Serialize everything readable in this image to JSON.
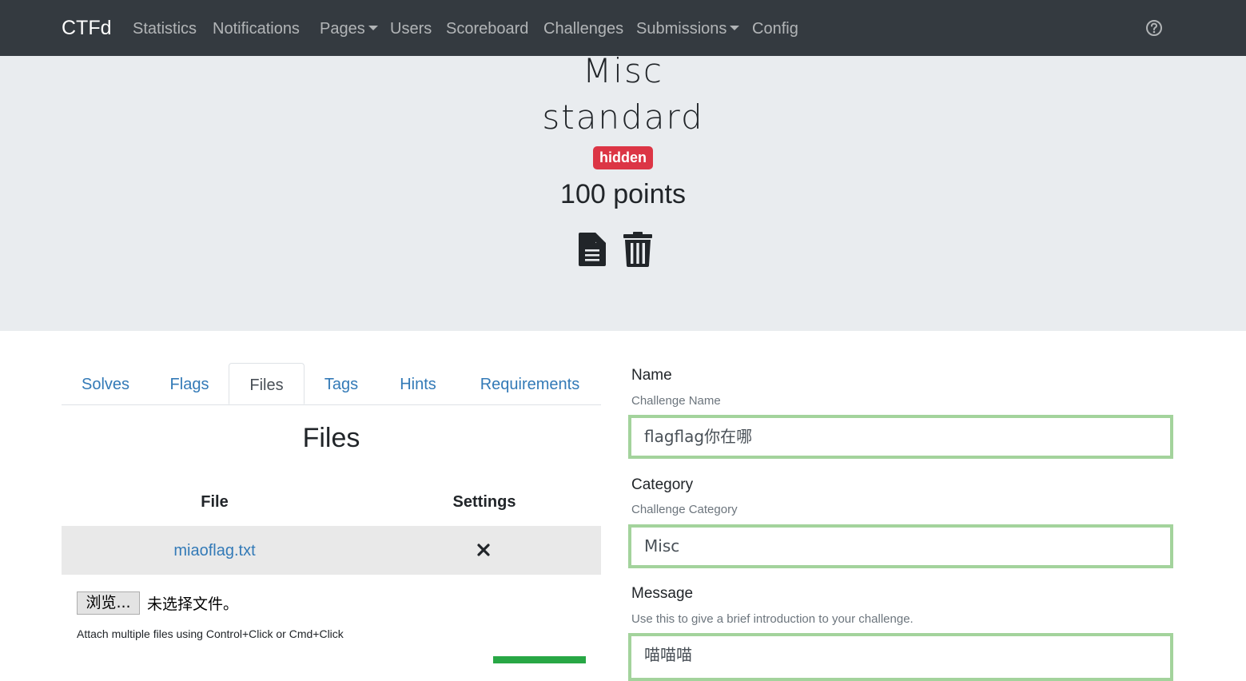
{
  "navbar": {
    "brand": "CTFd",
    "items": [
      "Statistics",
      "Notifications",
      "Pages",
      "Users",
      "Scoreboard",
      "Challenges",
      "Submissions",
      "Config"
    ]
  },
  "challenge": {
    "name": "Misc",
    "type": "standard",
    "state_badge": "hidden",
    "points": "100 points"
  },
  "tabs": [
    "Solves",
    "Flags",
    "Files",
    "Tags",
    "Hints",
    "Requirements"
  ],
  "active_tab": "Files",
  "files": {
    "title": "Files",
    "columns": [
      "File",
      "Settings"
    ],
    "rows": [
      {
        "file": "miaoflag.txt"
      }
    ],
    "browse_label": "浏览...",
    "no_file_text": "未选择文件。",
    "help": "Attach multiple files using Control+Click or Cmd+Click"
  },
  "form": {
    "name": {
      "label": "Name",
      "help": "Challenge Name",
      "value": "flagflag你在哪"
    },
    "category": {
      "label": "Category",
      "help": "Challenge Category",
      "value": "Misc"
    },
    "message": {
      "label": "Message",
      "help": "Use this to give a brief introduction to your challenge.",
      "value": "喵喵喵"
    }
  },
  "colors": {
    "navbar_bg": "#343a40",
    "jumbotron_bg": "#e9ecef",
    "badge_danger": "#dc3545",
    "link": "#337ab7",
    "input_valid_border": "#a3d39c",
    "success": "#28a745"
  }
}
